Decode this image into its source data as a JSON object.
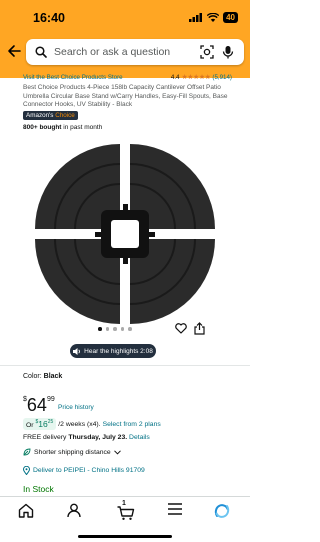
{
  "status_bar": {
    "time": "16:40",
    "battery": "40"
  },
  "search": {
    "placeholder": "Search or ask a question"
  },
  "store_link": "Visit the Best Choice Products Store",
  "rating": {
    "value": "4.4",
    "stars": "★★★★★",
    "count": "(5,914)"
  },
  "product": {
    "title": "Best Choice Products 4-Piece 158lb Capacity Cantilever Offset Patio Umbrella Circular Base Stand w/Carry Handles, Easy-Fill Spouts, Base Connector Hooks, UV Stability - Black",
    "badge_brand": "Amazon's",
    "badge_choice": "Choice",
    "bought_bold": "800+ bought",
    "bought_rest": "in past month"
  },
  "gallery": {
    "dot_count": 5,
    "active_dot": 0
  },
  "highlights": {
    "label": "Hear the highlights 2:08"
  },
  "color": {
    "label": "Color:",
    "value": "Black"
  },
  "price": {
    "currency": "$",
    "whole": "64",
    "fraction": "99",
    "history": "Price history"
  },
  "installment": {
    "prefix": "Or",
    "currency": "$",
    "whole": "16",
    "fraction": "25",
    "period": "/2 weeks (x4).",
    "link": "Select from 2 plans"
  },
  "delivery": {
    "prefix": "FREE delivery",
    "date": "Thursday, July 23.",
    "details": "Details"
  },
  "shorter_shipping": "Shorter shipping distance",
  "deliver_to": "Deliver to PEIPEI - Chino Hills 91709",
  "stock": "In Stock",
  "cart": {
    "count": "1"
  },
  "colors": {
    "header": "#ffa623",
    "link": "#007185",
    "stock": "#007600",
    "rating": "#de7921"
  }
}
